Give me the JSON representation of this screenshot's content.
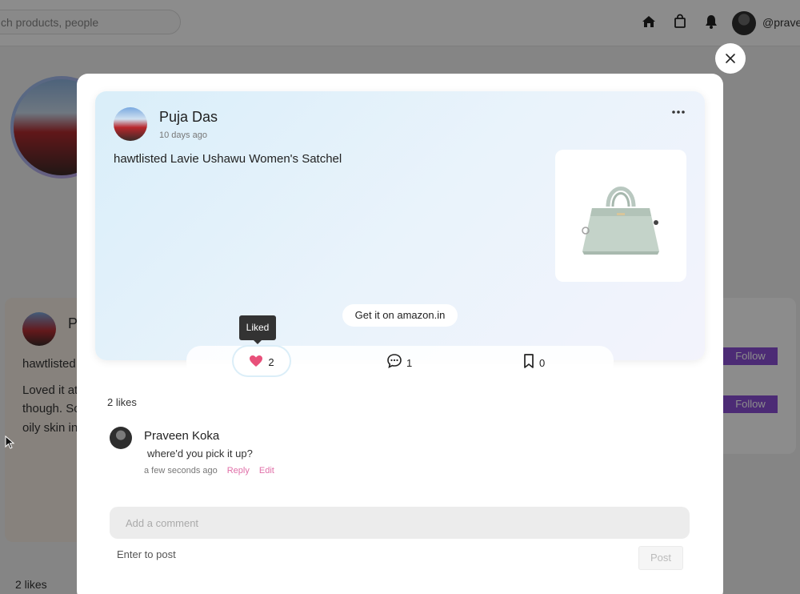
{
  "background": {
    "search_placeholder": "Search products, people",
    "search_visible_text": "ch products, people",
    "username": "@pravee",
    "left_card": {
      "initial": "P",
      "line1": "hawtlisted",
      "line2": "Loved it at",
      "line3": "though. So",
      "line4": "oily skin in",
      "likes": "2 likes"
    },
    "follow_label": "Follow"
  },
  "post": {
    "author": "Puja Das",
    "time": "10 days ago",
    "text": "hawtlisted Lavie Ushawu Women's Satchel",
    "cta": "Get it on amazon.in",
    "tooltip": "Liked",
    "like_count": "2",
    "comment_count": "1",
    "save_count": "0",
    "likes_summary": "2 likes",
    "liked": true,
    "accent_color": "#e8507a"
  },
  "comment": {
    "author": "Praveen Koka",
    "text": "where'd you pick it up?",
    "time": "a few seconds ago",
    "reply_label": "Reply",
    "edit_label": "Edit"
  },
  "composer": {
    "placeholder": "Add a comment",
    "hint": "Enter to post",
    "post_label": "Post"
  }
}
